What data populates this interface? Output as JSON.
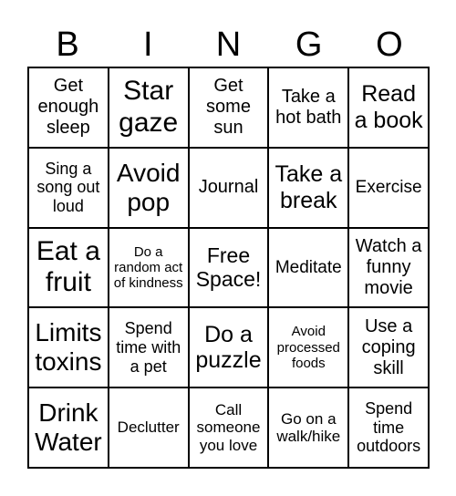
{
  "header": {
    "letters": [
      "B",
      "I",
      "N",
      "G",
      "O"
    ]
  },
  "cells": [
    "Get enough sleep",
    "Star gaze",
    "Get some sun",
    "Take a hot bath",
    "Read a book",
    "Sing a song out loud",
    "Avoid pop",
    "Journal",
    "Take a break",
    "Exercise",
    "Eat a fruit",
    "Do a random act of kindness",
    "Free Space!",
    "Meditate",
    "Watch a funny movie",
    "Limits toxins",
    "Spend time with a pet",
    "Do a puzzle",
    "Avoid processed foods",
    "Use a coping skill",
    "Drink Water",
    "Declutter",
    "Call someone you love",
    "Go on a walk/hike",
    "Spend time outdoors"
  ]
}
